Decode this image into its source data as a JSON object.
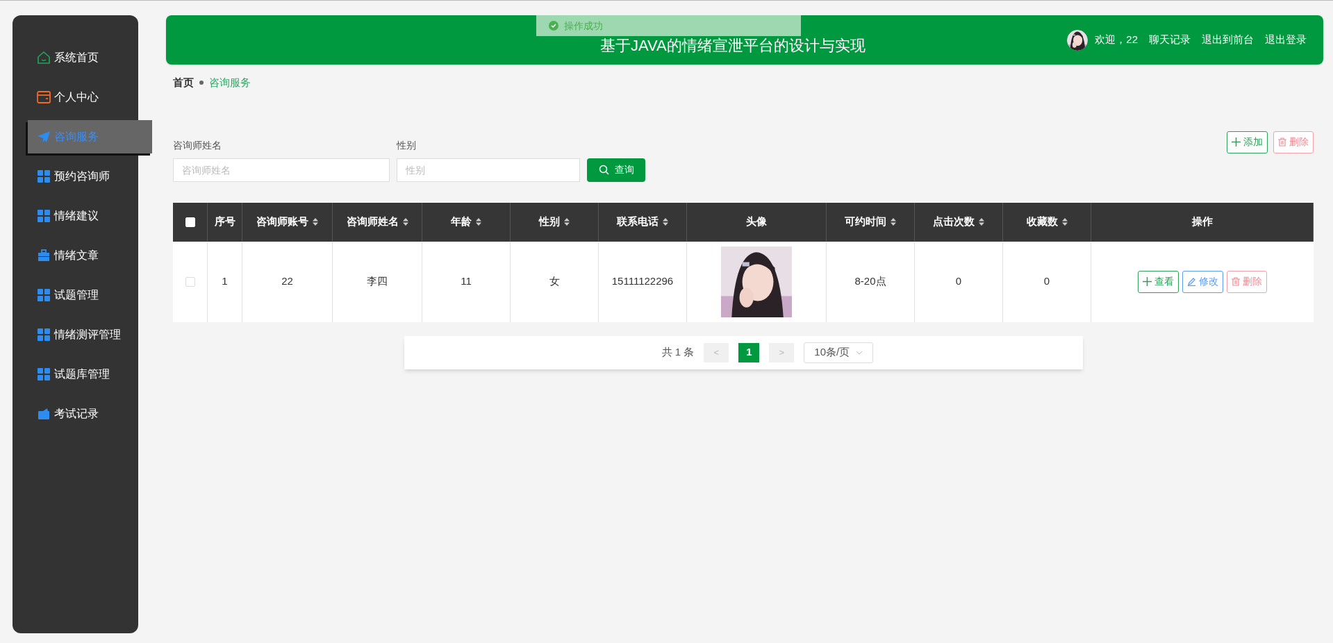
{
  "sidebar": {
    "items": [
      {
        "label": "系统首页",
        "selected": false
      },
      {
        "label": "个人中心",
        "selected": false
      },
      {
        "label": "咨询服务",
        "selected": true
      },
      {
        "label": "预约咨询师",
        "selected": false
      },
      {
        "label": "情绪建议",
        "selected": false
      },
      {
        "label": "情绪文章",
        "selected": false
      },
      {
        "label": "试题管理",
        "selected": false
      },
      {
        "label": "情绪测评管理",
        "selected": false
      },
      {
        "label": "试题库管理",
        "selected": false
      },
      {
        "label": "考试记录",
        "selected": false
      }
    ]
  },
  "header": {
    "title": "基于JAVA的情绪宣泄平台的设计与实现",
    "welcome": "欢迎，22",
    "links": [
      "聊天记录",
      "退出到前台",
      "退出登录"
    ]
  },
  "toast": {
    "message": "操作成功"
  },
  "breadcrumb": [
    "首页",
    "咨询服务"
  ],
  "filters": [
    {
      "label": "咨询师姓名",
      "placeholder": "咨询师姓名"
    },
    {
      "label": "性别",
      "placeholder": "性别"
    }
  ],
  "search_button": "查询",
  "toolbar_buttons": [
    {
      "kind": "add",
      "label": "添加"
    },
    {
      "kind": "delete",
      "label": "删除"
    }
  ],
  "table": {
    "header_checked": false,
    "columns": [
      {
        "label": "序号",
        "sortable": false
      },
      {
        "label": "咨询师账号",
        "sortable": true
      },
      {
        "label": "咨询师姓名",
        "sortable": true
      },
      {
        "label": "年龄",
        "sortable": true
      },
      {
        "label": "性别",
        "sortable": true
      },
      {
        "label": "联系电话",
        "sortable": true
      },
      {
        "label": "头像",
        "sortable": false
      },
      {
        "label": "可约时间",
        "sortable": true
      },
      {
        "label": "点击次数",
        "sortable": true
      },
      {
        "label": "收藏数",
        "sortable": true
      },
      {
        "label": "操作",
        "sortable": false
      }
    ],
    "rows": [
      {
        "checked": false,
        "cells": [
          "1",
          "22",
          "李四",
          "11",
          "女",
          "15111122296",
          null,
          "8-20点",
          "0",
          "0"
        ],
        "actions": [
          {
            "kind": "view",
            "label": "查看"
          },
          {
            "kind": "edit",
            "label": "修改"
          },
          {
            "kind": "delete",
            "label": "删除"
          }
        ]
      }
    ]
  },
  "pagination": {
    "total": "共 1 条",
    "prev": "<",
    "pages": [
      {
        "label": "1",
        "selected": true
      }
    ],
    "next": ">",
    "page_size": "10条/页"
  }
}
